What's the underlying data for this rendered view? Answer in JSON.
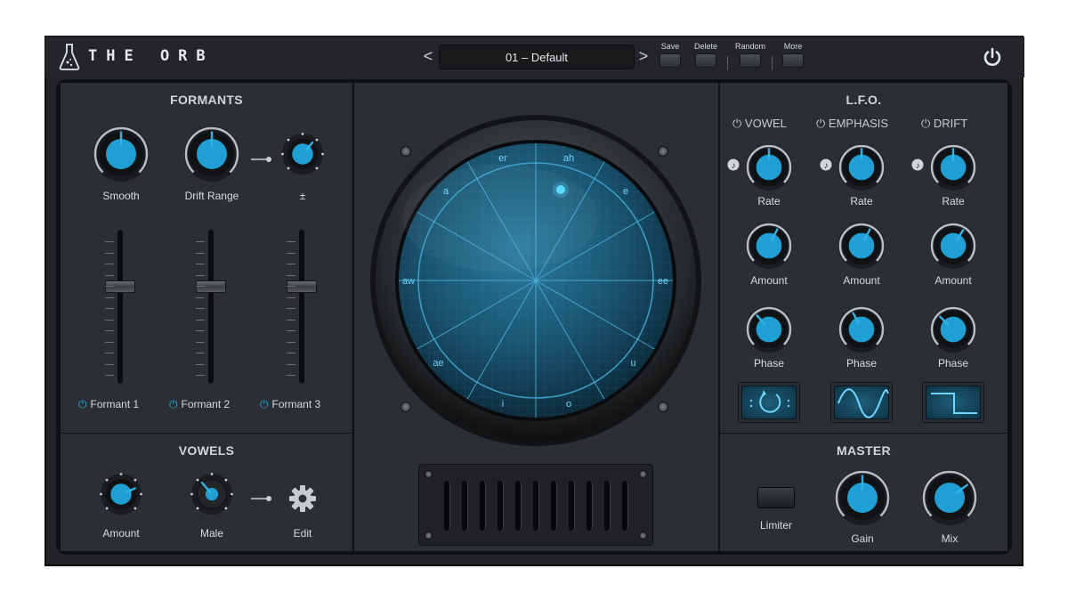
{
  "header": {
    "title": "THE ORB",
    "preset": {
      "name": "01 – Default",
      "prev": "<",
      "next": ">"
    },
    "buttons": [
      {
        "label": "Save"
      },
      {
        "label": "Delete"
      },
      {
        "label": "Random"
      },
      {
        "label": "More"
      }
    ],
    "icons": {
      "logo": "flask-icon",
      "power": "power-icon"
    }
  },
  "formants": {
    "title": "FORMANTS",
    "knobs": [
      {
        "label": "Smooth",
        "value": 0.5
      },
      {
        "label": "Drift Range",
        "value": 0.5
      },
      {
        "label": "±",
        "value": 0.65
      }
    ],
    "faders": [
      {
        "label": "Formant 1",
        "value": 0.5
      },
      {
        "label": "Formant 2",
        "value": 0.5
      },
      {
        "label": "Formant 3",
        "value": 0.5
      }
    ]
  },
  "vowels": {
    "title": "VOWELS",
    "amount_label": "Amount",
    "amount_value": 0.75,
    "voice_label": "Male",
    "voice_value": 0.35,
    "edit_label": "Edit"
  },
  "orb": {
    "sectors": [
      "er",
      "ah",
      "e",
      "ee",
      "u",
      "o",
      "i",
      "ae",
      "aw",
      "a"
    ]
  },
  "lfo": {
    "title": "L.F.O.",
    "columns": [
      {
        "name": "VOWEL",
        "rate_label": "Rate",
        "rate": 0.5,
        "amount_label": "Amount",
        "amount": 0.6,
        "phase_label": "Phase",
        "phase": 0.35,
        "wave": "circle-loop"
      },
      {
        "name": "EMPHASIS",
        "rate_label": "Rate",
        "rate": 0.5,
        "amount_label": "Amount",
        "amount": 0.6,
        "phase_label": "Phase",
        "phase": 0.4,
        "wave": "sine"
      },
      {
        "name": "DRIFT",
        "rate_label": "Rate",
        "rate": 0.5,
        "amount_label": "Amount",
        "amount": 0.62,
        "phase_label": "Phase",
        "phase": 0.33,
        "wave": "square"
      }
    ]
  },
  "master": {
    "title": "MASTER",
    "limiter_label": "Limiter",
    "gain_label": "Gain",
    "gain": 0.5,
    "mix_label": "Mix",
    "mix": 0.7
  },
  "colors": {
    "accent": "#22a5d8",
    "panel": "#2b2e32",
    "frame": "#0f1011"
  }
}
